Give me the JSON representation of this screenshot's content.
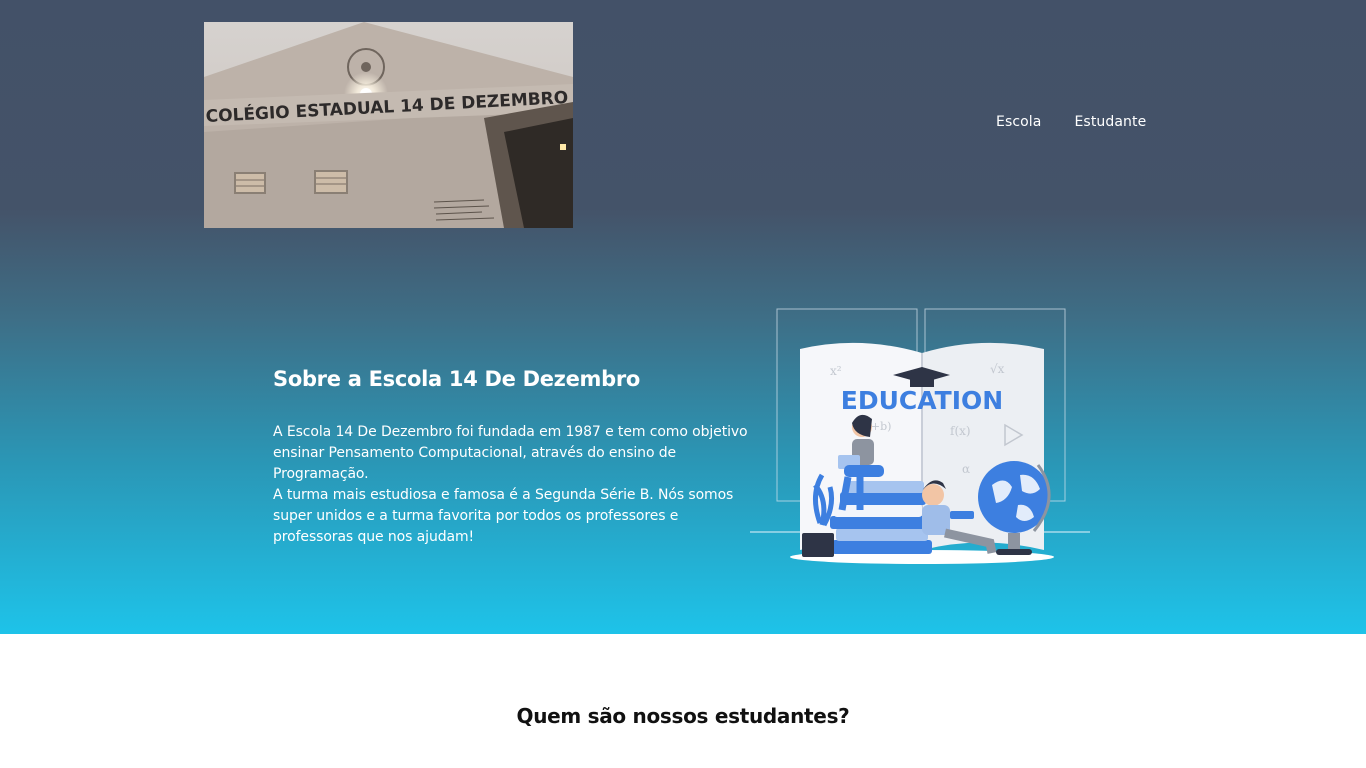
{
  "header": {
    "logo_photo_text": "COLÉGIO ESTADUAL 14 DE DEZEMBRO",
    "nav": [
      {
        "label": "Escola"
      },
      {
        "label": "Estudante"
      }
    ]
  },
  "about": {
    "title": "Sobre a Escola 14 De Dezembro",
    "paragraph_1": "A Escola 14 De Dezembro foi fundada em 1987 e tem como objetivo ensinar Pensamento Computacional, através do ensino de Programação.",
    "paragraph_2": "A turma mais estudiosa e famosa é a Segunda Série B. Nós somos super unidos e a turma favorita por todos os professores e professoras que nos ajudam!",
    "illustration_text": "EDUCATION"
  },
  "students": {
    "title": "Quem são nossos estudantes?"
  },
  "colors": {
    "hero_top": "#435168",
    "hero_bottom": "#1ec3e9",
    "illustration_blue": "#3d7fe0"
  }
}
